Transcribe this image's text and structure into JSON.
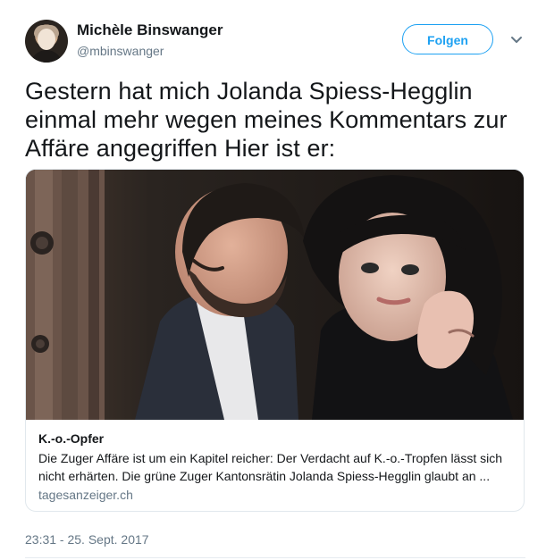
{
  "author": {
    "name": "Michèle Binswanger",
    "handle": "@mbinswanger"
  },
  "actions": {
    "follow_label": "Folgen",
    "more_icon": "chevron-down-icon"
  },
  "tweet": {
    "text": "Gestern hat mich Jolanda Spiess-Hegglin einmal mehr wegen meines Kommentars zur Affäre angegriffen Hier ist er:",
    "timestamp": "23:31 - 25. Sept. 2017"
  },
  "card": {
    "title": "K.-o.-Opfer",
    "description_line1": "Die Zuger Affäre ist um ein Kapitel reicher: Der Verdacht auf K.-o.-Tropfen lässt sich",
    "description_line2": "nicht erhärten. Die grüne Zuger Kantonsrätin Jolanda Spiess-Hegglin glaubt an ...",
    "domain": "tagesanzeiger.ch"
  },
  "colors": {
    "accent": "#1da1f2",
    "secondary_text": "#657786",
    "border": "#e1e8ed"
  }
}
